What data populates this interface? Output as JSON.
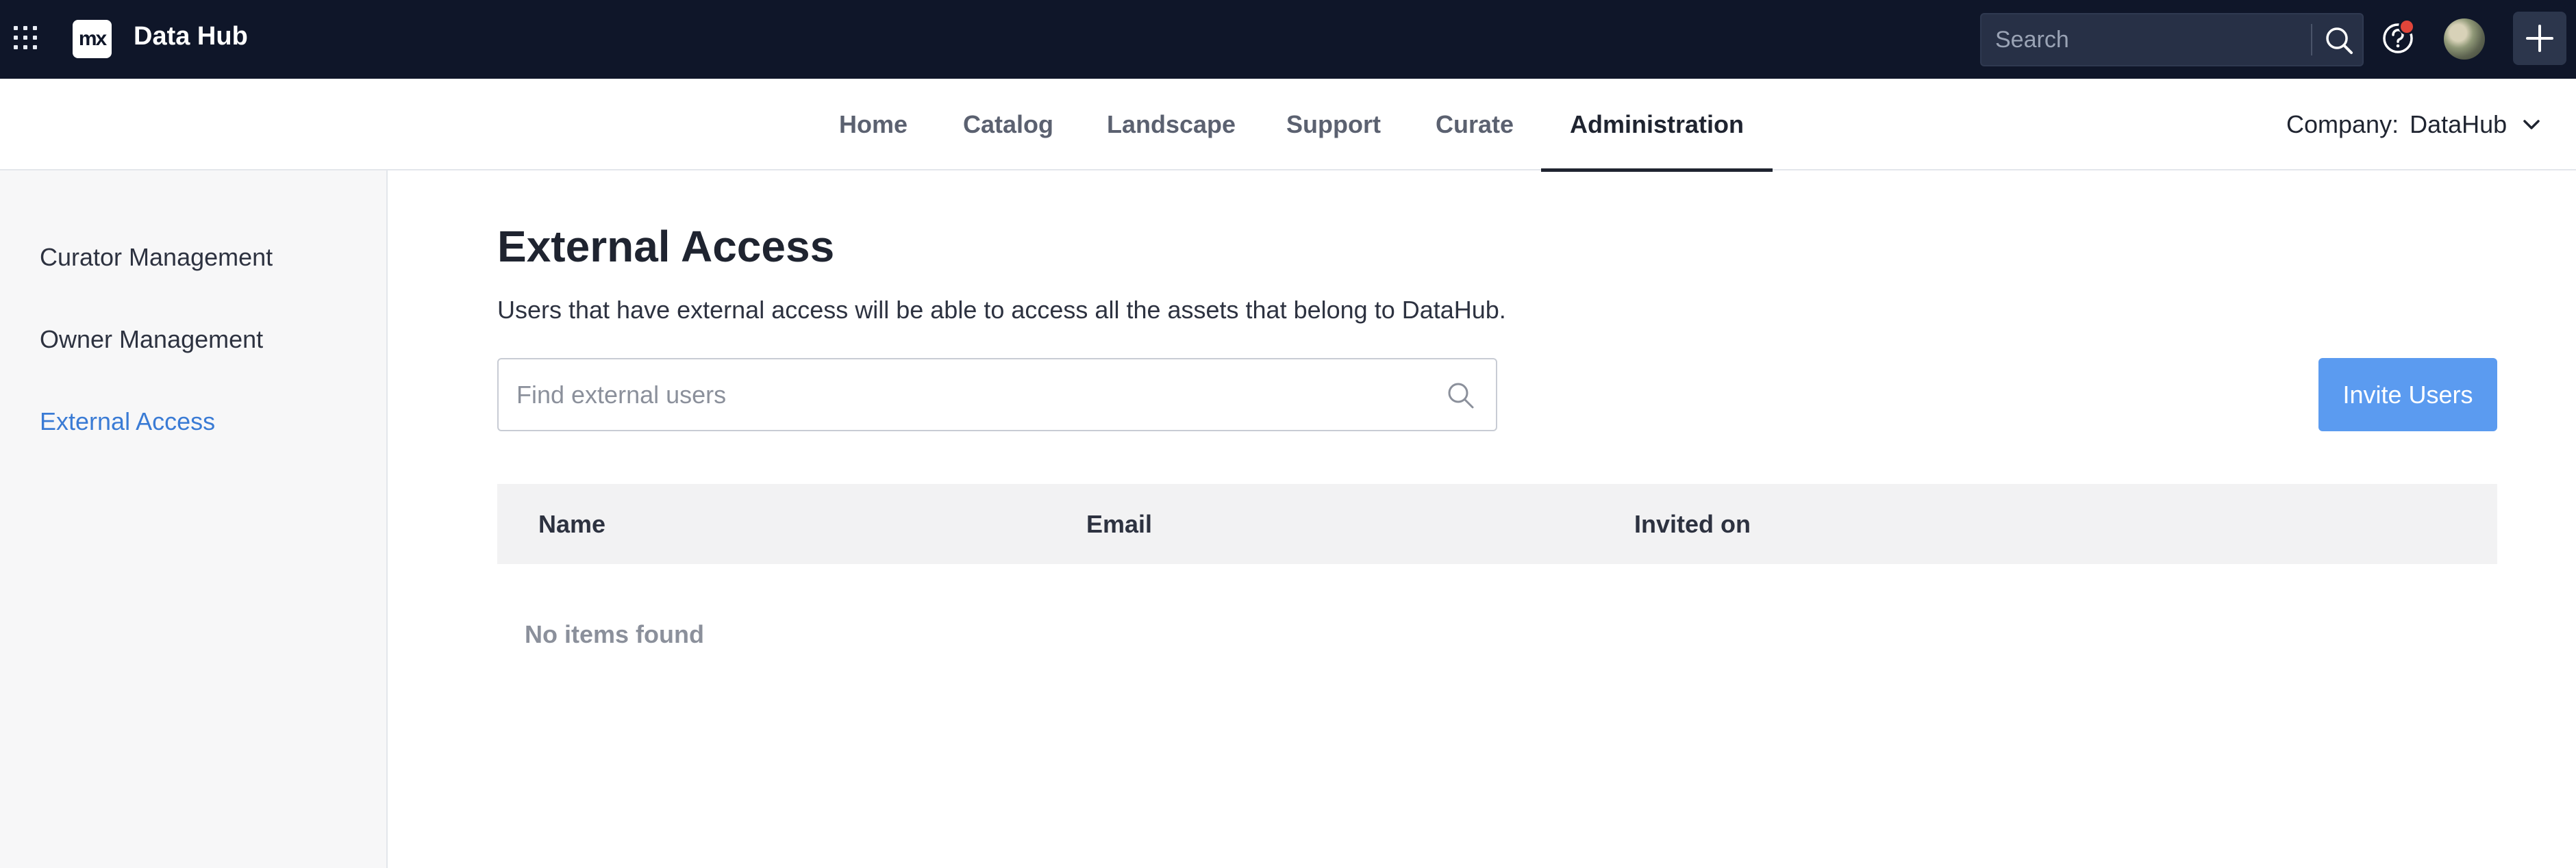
{
  "app": {
    "logo_text": "mx",
    "name": "Data Hub"
  },
  "topbar": {
    "search_placeholder": "Search",
    "icons": [
      "apps-grid-icon",
      "search-icon",
      "help-icon",
      "avatar",
      "plus-icon"
    ],
    "accent": "#0f1629",
    "notification_color": "#e0453a"
  },
  "nav": {
    "items": [
      {
        "label": "Home"
      },
      {
        "label": "Catalog"
      },
      {
        "label": "Landscape"
      },
      {
        "label": "Support"
      },
      {
        "label": "Curate"
      },
      {
        "label": "Administration",
        "active": true
      }
    ],
    "company_label": "Company:",
    "company_value": "DataHub"
  },
  "sidebar": {
    "items": [
      {
        "label": "Curator Management"
      },
      {
        "label": "Owner Management"
      },
      {
        "label": "External Access",
        "active": true
      }
    ],
    "active_color": "#3a7bd5"
  },
  "main": {
    "title": "External Access",
    "description": "Users that have external access will be able to access all the assets that belong to DataHub.",
    "find_placeholder": "Find external users",
    "invite_label": "Invite Users",
    "invite_color": "#5b9bf0",
    "table": {
      "columns": [
        "Name",
        "Email",
        "Invited on"
      ],
      "rows": [],
      "empty_text": "No items found"
    }
  }
}
